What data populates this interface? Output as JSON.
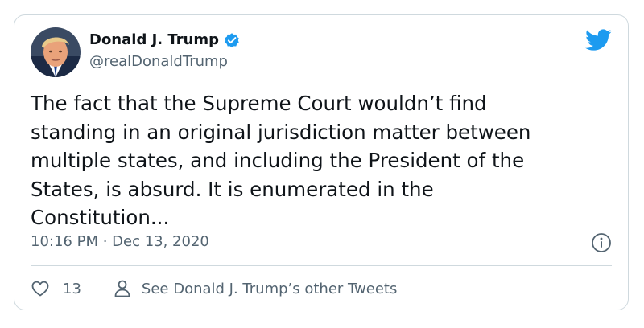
{
  "tweet": {
    "display_name": "Donald J. Trump",
    "handle": "@realDonaldTrump",
    "text_lines": [
      "The fact that the Supreme Court wouldn’t find",
      "standing in an original jurisdiction matter between",
      "multiple states, and including the President of the",
      "States, is absurd. It is enumerated in the",
      "Constitution..."
    ],
    "timestamp": "10:16 PM · Dec 13, 2020",
    "like_count": "13",
    "other_tweets_label": "See Donald J. Trump’s other Tweets"
  },
  "icons": {
    "avatar": "profile-avatar",
    "verified": "verified-badge-icon",
    "brand": "twitter-bird-icon",
    "info": "info-icon",
    "like": "heart-icon",
    "profile": "person-icon"
  },
  "colors": {
    "accent": "#1d9bf0",
    "text": "#0f1419",
    "muted": "#536471",
    "border": "#cfd9de"
  }
}
